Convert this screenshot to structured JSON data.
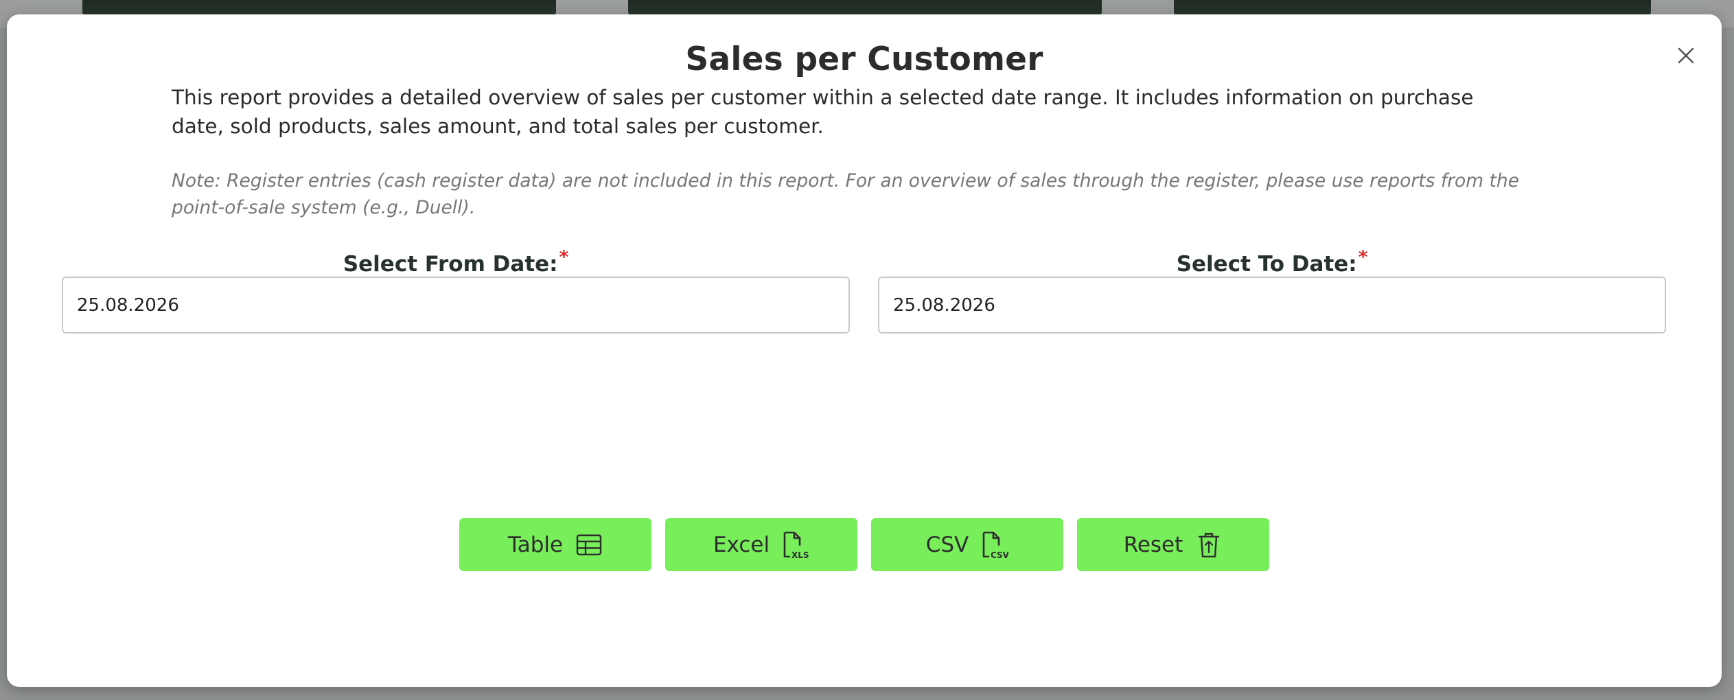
{
  "modal": {
    "title": "Sales per Customer",
    "description": "This report provides a detailed overview of sales per customer within a selected date range. It includes information on purchase date, sold products, sales amount, and total sales per customer.",
    "note": "Note: Register entries (cash register data) are not included in this report. For an overview of sales through the register, please use reports from the point-of-sale system (e.g., Duell).",
    "close_icon": "close-icon"
  },
  "form": {
    "from_label": "Select From Date:",
    "from_value": "25.08.2026",
    "to_label": "Select To Date:",
    "to_value": "25.08.2026",
    "required_marker": "*"
  },
  "actions": {
    "table_label": "Table",
    "table_icon": "table-icon",
    "excel_label": "Excel",
    "excel_icon": "xls-file-icon",
    "csv_label": "CSV",
    "csv_icon": "csv-file-icon",
    "reset_label": "Reset",
    "reset_icon": "trash-icon"
  },
  "colors": {
    "button_bg": "#78ee5a",
    "required": "#e02424",
    "title": "#2c2c2c"
  }
}
